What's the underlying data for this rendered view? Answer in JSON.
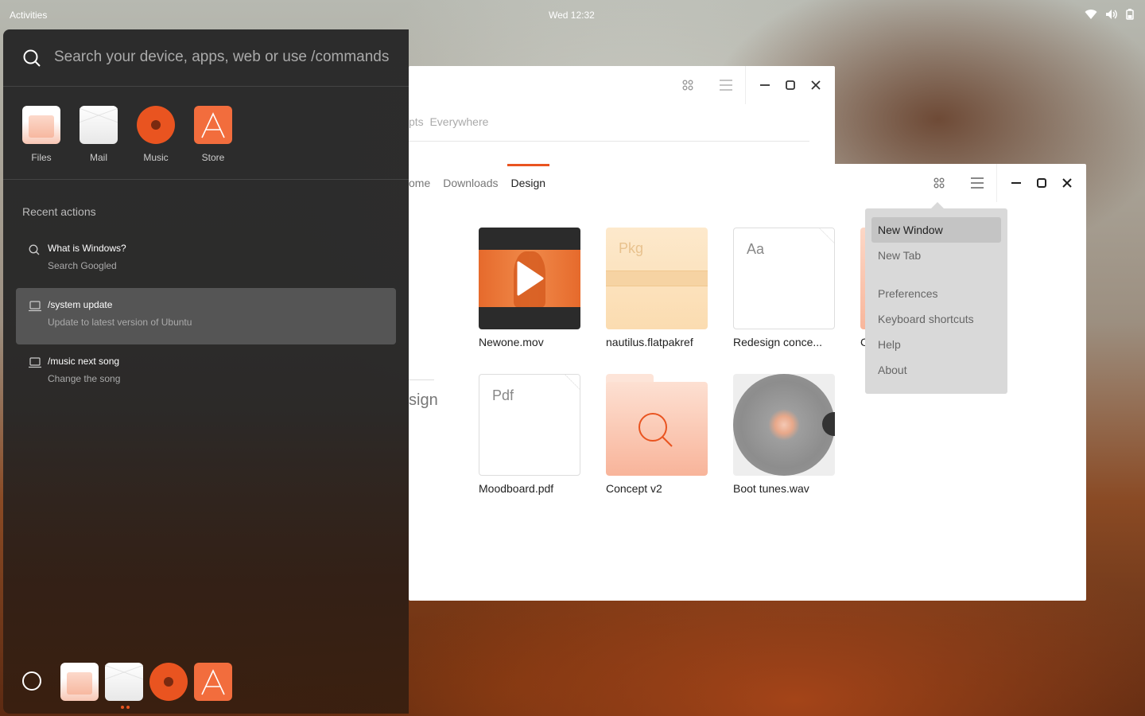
{
  "topbar": {
    "activities": "Activities",
    "clock": "Wed 12:32"
  },
  "back_window": {
    "tabs_text": "pts",
    "tabs_active": "Everywhere"
  },
  "main_window": {
    "tabs": [
      {
        "label": "ome"
      },
      {
        "label": "Downloads"
      },
      {
        "label": "Design"
      }
    ],
    "side_label": "sign",
    "files": [
      {
        "name": "Newone.mov",
        "kind": "video"
      },
      {
        "name": "nautilus.flatpakref",
        "kind": "package",
        "label": "Pkg"
      },
      {
        "name": "Redesign conce...",
        "kind": "font",
        "label": "Aa"
      },
      {
        "name": "Moodboard.pdf",
        "kind": "pdf",
        "label": "Pdf"
      },
      {
        "name": "Concept v2",
        "kind": "folder"
      },
      {
        "name": "Boot tunes.wav",
        "kind": "audio"
      }
    ],
    "partial_file_name": "C"
  },
  "menu": {
    "items": [
      {
        "label": "New Window"
      },
      {
        "label": "New Tab"
      },
      {
        "label": "Preferences"
      },
      {
        "label": "Keyboard shortcuts"
      },
      {
        "label": "Help"
      },
      {
        "label": "About"
      }
    ]
  },
  "launcher": {
    "search_placeholder": "Search your device, apps, web or use /commands",
    "apps": [
      {
        "label": "Files",
        "icon": "files-icon"
      },
      {
        "label": "Mail",
        "icon": "mail-icon"
      },
      {
        "label": "Music",
        "icon": "music-icon"
      },
      {
        "label": "Store",
        "icon": "store-icon"
      }
    ],
    "recent_title": "Recent actions",
    "actions": [
      {
        "title": "What is Windows?",
        "subtitle": "Search Googled",
        "icon": "search-icon"
      },
      {
        "title": "/system update",
        "subtitle": "Update to latest version of Ubuntu",
        "icon": "laptop-icon"
      },
      {
        "title": "/music next song",
        "subtitle": "Change the song",
        "icon": "laptop-icon"
      }
    ]
  },
  "colors": {
    "accent": "#e95420",
    "menu_bg": "#d9d9d9"
  }
}
